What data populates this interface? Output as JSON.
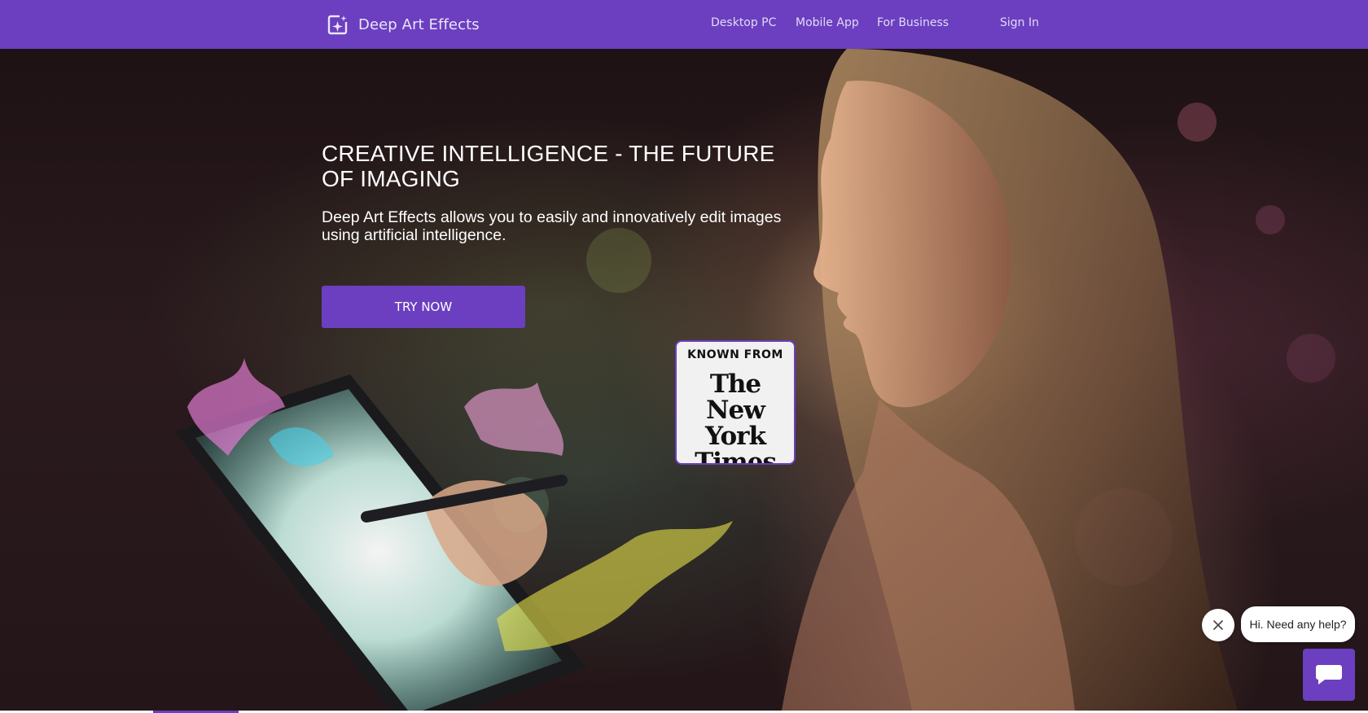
{
  "nav": {
    "brand": "Deep Art Effects",
    "links": [
      "Desktop PC",
      "Mobile App",
      "For Business"
    ],
    "sign_in": "Sign In"
  },
  "hero": {
    "title": "CREATIVE INTELLIGENCE - THE FUTURE OF IMAGING",
    "subtitle": "Deep Art Effects allows you to easily and innovatively edit images using artificial intelligence.",
    "cta": "TRY NOW"
  },
  "badge": {
    "heading": "KNOWN FROM",
    "logo_line1": "The",
    "logo_line2": "New York",
    "logo_line3": "Times"
  },
  "chat": {
    "prompt": "Hi. Need any help?",
    "close_icon": "close-icon",
    "launcher_icon": "chat-icon"
  },
  "colors": {
    "brand": "#6b3fbf",
    "hero_bg": "#1e1214"
  }
}
